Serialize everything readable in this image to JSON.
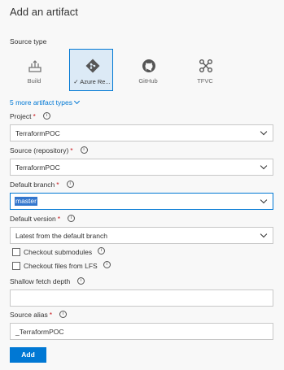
{
  "panel": {
    "title": "Add an artifact"
  },
  "source_type": {
    "label": "Source type",
    "tiles": [
      {
        "label": "Build",
        "icon": "build-icon",
        "selected": false
      },
      {
        "label": "Azure Re...",
        "icon": "azure-repos-icon",
        "selected": true
      },
      {
        "label": "GitHub",
        "icon": "github-icon",
        "selected": false
      },
      {
        "label": "TFVC",
        "icon": "tfvc-icon",
        "selected": false
      }
    ],
    "more_link": "5 more artifact types"
  },
  "project": {
    "label": "Project",
    "required": "*",
    "value": "TerraformPOC"
  },
  "source_repo": {
    "label": "Source (repository)",
    "required": "*",
    "value": "TerraformPOC"
  },
  "default_branch": {
    "label": "Default branch",
    "required": "*",
    "value": "master"
  },
  "default_version": {
    "label": "Default version",
    "required": "*",
    "value": "Latest from the default branch"
  },
  "checkboxes": {
    "submodules": "Checkout submodules",
    "lfs": "Checkout files from LFS"
  },
  "shallow_fetch": {
    "label": "Shallow fetch depth",
    "value": ""
  },
  "source_alias": {
    "label": "Source alias",
    "required": "*",
    "value": "_TerraformPOC"
  },
  "actions": {
    "add_label": "Add"
  },
  "colors": {
    "accent": "#0078d4",
    "required": "#c8191e",
    "selection": "#3376cd"
  }
}
